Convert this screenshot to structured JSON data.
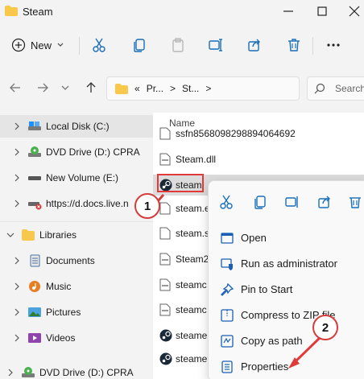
{
  "window": {
    "title": "Steam"
  },
  "toolbar": {
    "new_label": "New"
  },
  "address": {
    "crumbs": [
      "«",
      "Pr...",
      ">",
      "St...",
      ">"
    ],
    "search_placeholder": "Search"
  },
  "sidebar": {
    "items": [
      {
        "label": "Local Disk (C:)",
        "icon": "drive-icon",
        "selected": true
      },
      {
        "label": "DVD Drive (D:) CPRA",
        "icon": "dvd-icon"
      },
      {
        "label": "New Volume (E:)",
        "icon": "drive-icon"
      },
      {
        "label": "https://d.docs.live.n",
        "icon": "network-drive-icon"
      },
      {
        "label": "Libraries",
        "icon": "folder-icon"
      },
      {
        "label": "Documents",
        "icon": "documents-icon"
      },
      {
        "label": "Music",
        "icon": "music-icon"
      },
      {
        "label": "Pictures",
        "icon": "pictures-icon"
      },
      {
        "label": "Videos",
        "icon": "videos-icon"
      },
      {
        "label": "DVD Drive (D:) CPRA",
        "icon": "dvd-icon"
      }
    ]
  },
  "filelist": {
    "column_name": "Name",
    "files": [
      {
        "name": "ssfn8568098298894064692",
        "icon": "file-icon"
      },
      {
        "name": "Steam.dll",
        "icon": "dll-icon"
      },
      {
        "name": "steam",
        "icon": "steam-icon"
      },
      {
        "name": "steam.e",
        "icon": "file-icon"
      },
      {
        "name": "steam.s",
        "icon": "file-icon"
      },
      {
        "name": "Steam2",
        "icon": "dll-icon"
      },
      {
        "name": "steamc",
        "icon": "dll-icon"
      },
      {
        "name": "steamc",
        "icon": "dll-icon"
      },
      {
        "name": "steame",
        "icon": "steam-icon"
      },
      {
        "name": "steame",
        "icon": "steam-icon"
      }
    ]
  },
  "context_menu": {
    "items": [
      {
        "label": "Open",
        "icon": "open-icon"
      },
      {
        "label": "Run as administrator",
        "icon": "shield-icon"
      },
      {
        "label": "Pin to Start",
        "icon": "pin-icon"
      },
      {
        "label": "Compress to ZIP file",
        "icon": "zip-icon"
      },
      {
        "label": "Copy as path",
        "icon": "copy-path-icon"
      },
      {
        "label": "Properties",
        "icon": "properties-icon"
      }
    ]
  },
  "callouts": {
    "step1": "1",
    "step2": "2"
  },
  "colors": {
    "accent": "#0067c0",
    "callout_red": "#e13a3a"
  }
}
